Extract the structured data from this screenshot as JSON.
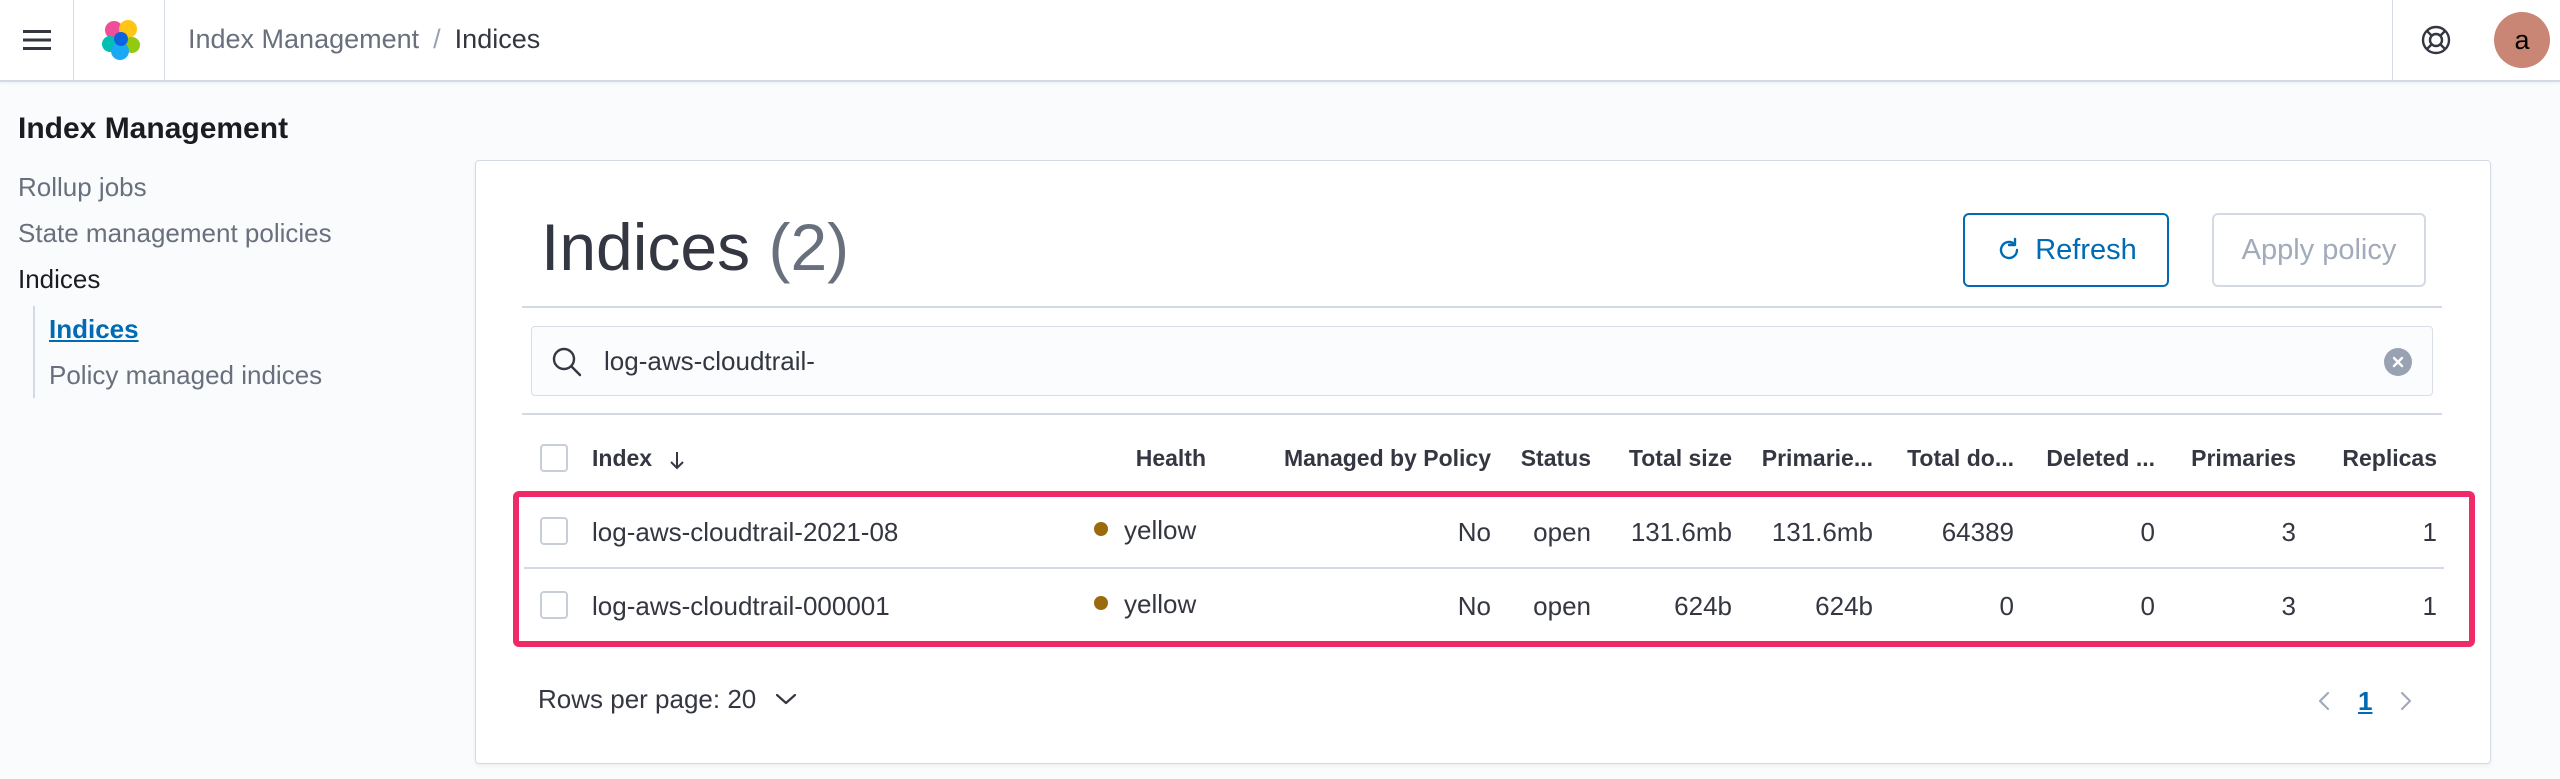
{
  "header": {
    "breadcrumbs": [
      "Index Management",
      "Indices"
    ],
    "avatar_initial": "a"
  },
  "sidebar": {
    "title": "Index Management",
    "items": [
      "Rollup jobs",
      "State management policies",
      "Indices"
    ],
    "sub_items": [
      "Indices",
      "Policy managed indices"
    ]
  },
  "main": {
    "title": "Indices",
    "count": "(2)",
    "refresh_label": "Refresh",
    "apply_policy_label": "Apply policy",
    "search_value": "log-aws-cloudtrail-",
    "columns": [
      "Index",
      "Health",
      "Managed by Policy",
      "Status",
      "Total size",
      "Primarie...",
      "Total do...",
      "Deleted ...",
      "Primaries",
      "Replicas"
    ],
    "rows": [
      {
        "index": "log-aws-cloudtrail-2021-08",
        "health": "yellow",
        "managed": "No",
        "status": "open",
        "total_size": "131.6mb",
        "primaries_size": "131.6mb",
        "total_docs": "64389",
        "deleted": "0",
        "primaries": "3",
        "replicas": "1"
      },
      {
        "index": "log-aws-cloudtrail-000001",
        "health": "yellow",
        "managed": "No",
        "status": "open",
        "total_size": "624b",
        "primaries_size": "624b",
        "total_docs": "0",
        "deleted": "0",
        "primaries": "3",
        "replicas": "1"
      }
    ],
    "rows_per_page": "Rows per page: 20",
    "current_page": "1"
  },
  "colors": {
    "accent": "#006bb4",
    "highlight": "#ef2a69",
    "health_yellow": "#9b6a0d",
    "avatar": "#c98674"
  }
}
